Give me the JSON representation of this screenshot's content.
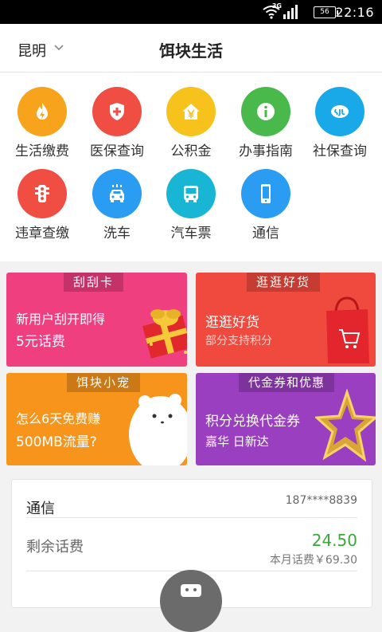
{
  "status_bar": {
    "network": "3G",
    "battery": "56",
    "time": "22:16"
  },
  "header": {
    "city": "昆明",
    "title": "饵块生活"
  },
  "services": [
    {
      "label": "生活缴费",
      "icon": "flame-icon",
      "color": "#f7a31c"
    },
    {
      "label": "医保查询",
      "icon": "medical-shield-icon",
      "color": "#f04d43"
    },
    {
      "label": "公积金",
      "icon": "house-yen-icon",
      "color": "#f7c21c"
    },
    {
      "label": "办事指南",
      "icon": "info-icon",
      "color": "#49b94c"
    },
    {
      "label": "社保查询",
      "icon": "social-security-icon",
      "color": "#19a8e8"
    },
    {
      "label": "违章查缴",
      "icon": "traffic-light-icon",
      "color": "#f04d43"
    },
    {
      "label": "洗车",
      "icon": "car-wash-icon",
      "color": "#2a9cf2"
    },
    {
      "label": "汽车票",
      "icon": "bus-icon",
      "color": "#19b5d5"
    },
    {
      "label": "通信",
      "icon": "phone-icon",
      "color": "#2a9cf2"
    }
  ],
  "promos": {
    "scratch": {
      "tag": "刮刮卡",
      "line1": "新用户刮开即得",
      "line2": "5元话费",
      "color": "#ef3f7f"
    },
    "shopping": {
      "tag": "逛逛好货",
      "line1": "逛逛好货",
      "line2": "部分支持积分",
      "color": "#f04a3e"
    },
    "pet": {
      "tag": "饵块小宠",
      "line1": "怎么6天免费赚",
      "line2": "500MB流量?",
      "color": "#f7941c"
    },
    "voucher": {
      "tag": "代金券和优惠",
      "line1": "积分兑换代金券",
      "line2": "嘉华 日新达",
      "color": "#9a3fbf"
    }
  },
  "telecom": {
    "title": "通信",
    "phone": "187****8839",
    "balance_label": "剩余话费",
    "balance_value": "24.50",
    "monthly": "本月话费￥69.30"
  }
}
